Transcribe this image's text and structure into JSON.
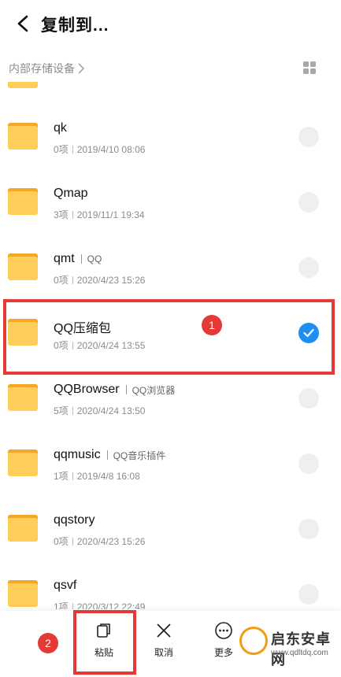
{
  "header": {
    "title": "复制到..."
  },
  "path": {
    "breadcrumb": "内部存储设备"
  },
  "list": {
    "items": [
      {
        "name": "qk",
        "tag": "",
        "count": "0项",
        "date": "2019/4/10 08:06",
        "checked": false
      },
      {
        "name": "Qmap",
        "tag": "",
        "count": "3项",
        "date": "2019/11/1 19:34",
        "checked": false
      },
      {
        "name": "qmt",
        "tag": "QQ",
        "count": "0项",
        "date": "2020/4/23 15:26",
        "checked": false
      },
      {
        "name": "QQ压缩包",
        "tag": "",
        "count": "0项",
        "date": "2020/4/24 13:55",
        "checked": true
      },
      {
        "name": "QQBrowser",
        "tag": "QQ浏览器",
        "count": "5项",
        "date": "2020/4/24 13:50",
        "checked": false
      },
      {
        "name": "qqmusic",
        "tag": "QQ音乐插件",
        "count": "1项",
        "date": "2019/4/8 16:08",
        "checked": false
      },
      {
        "name": "qqstory",
        "tag": "",
        "count": "0项",
        "date": "2020/4/23 15:26",
        "checked": false
      },
      {
        "name": "qsvf",
        "tag": "",
        "count": "1项",
        "date": "2020/3/12 22:49",
        "checked": false
      }
    ]
  },
  "annotations": {
    "step1": "1",
    "step2": "2"
  },
  "toolbar": {
    "paste_label": "粘贴",
    "cancel_label": "取消",
    "more_label": "更多"
  },
  "watermark": {
    "brand": "启东安卓网",
    "url": "www.qdltdq.com"
  },
  "colors": {
    "accent": "#1e8ff0",
    "annotation_red": "#e53935",
    "folder": "#ffcd5a"
  }
}
